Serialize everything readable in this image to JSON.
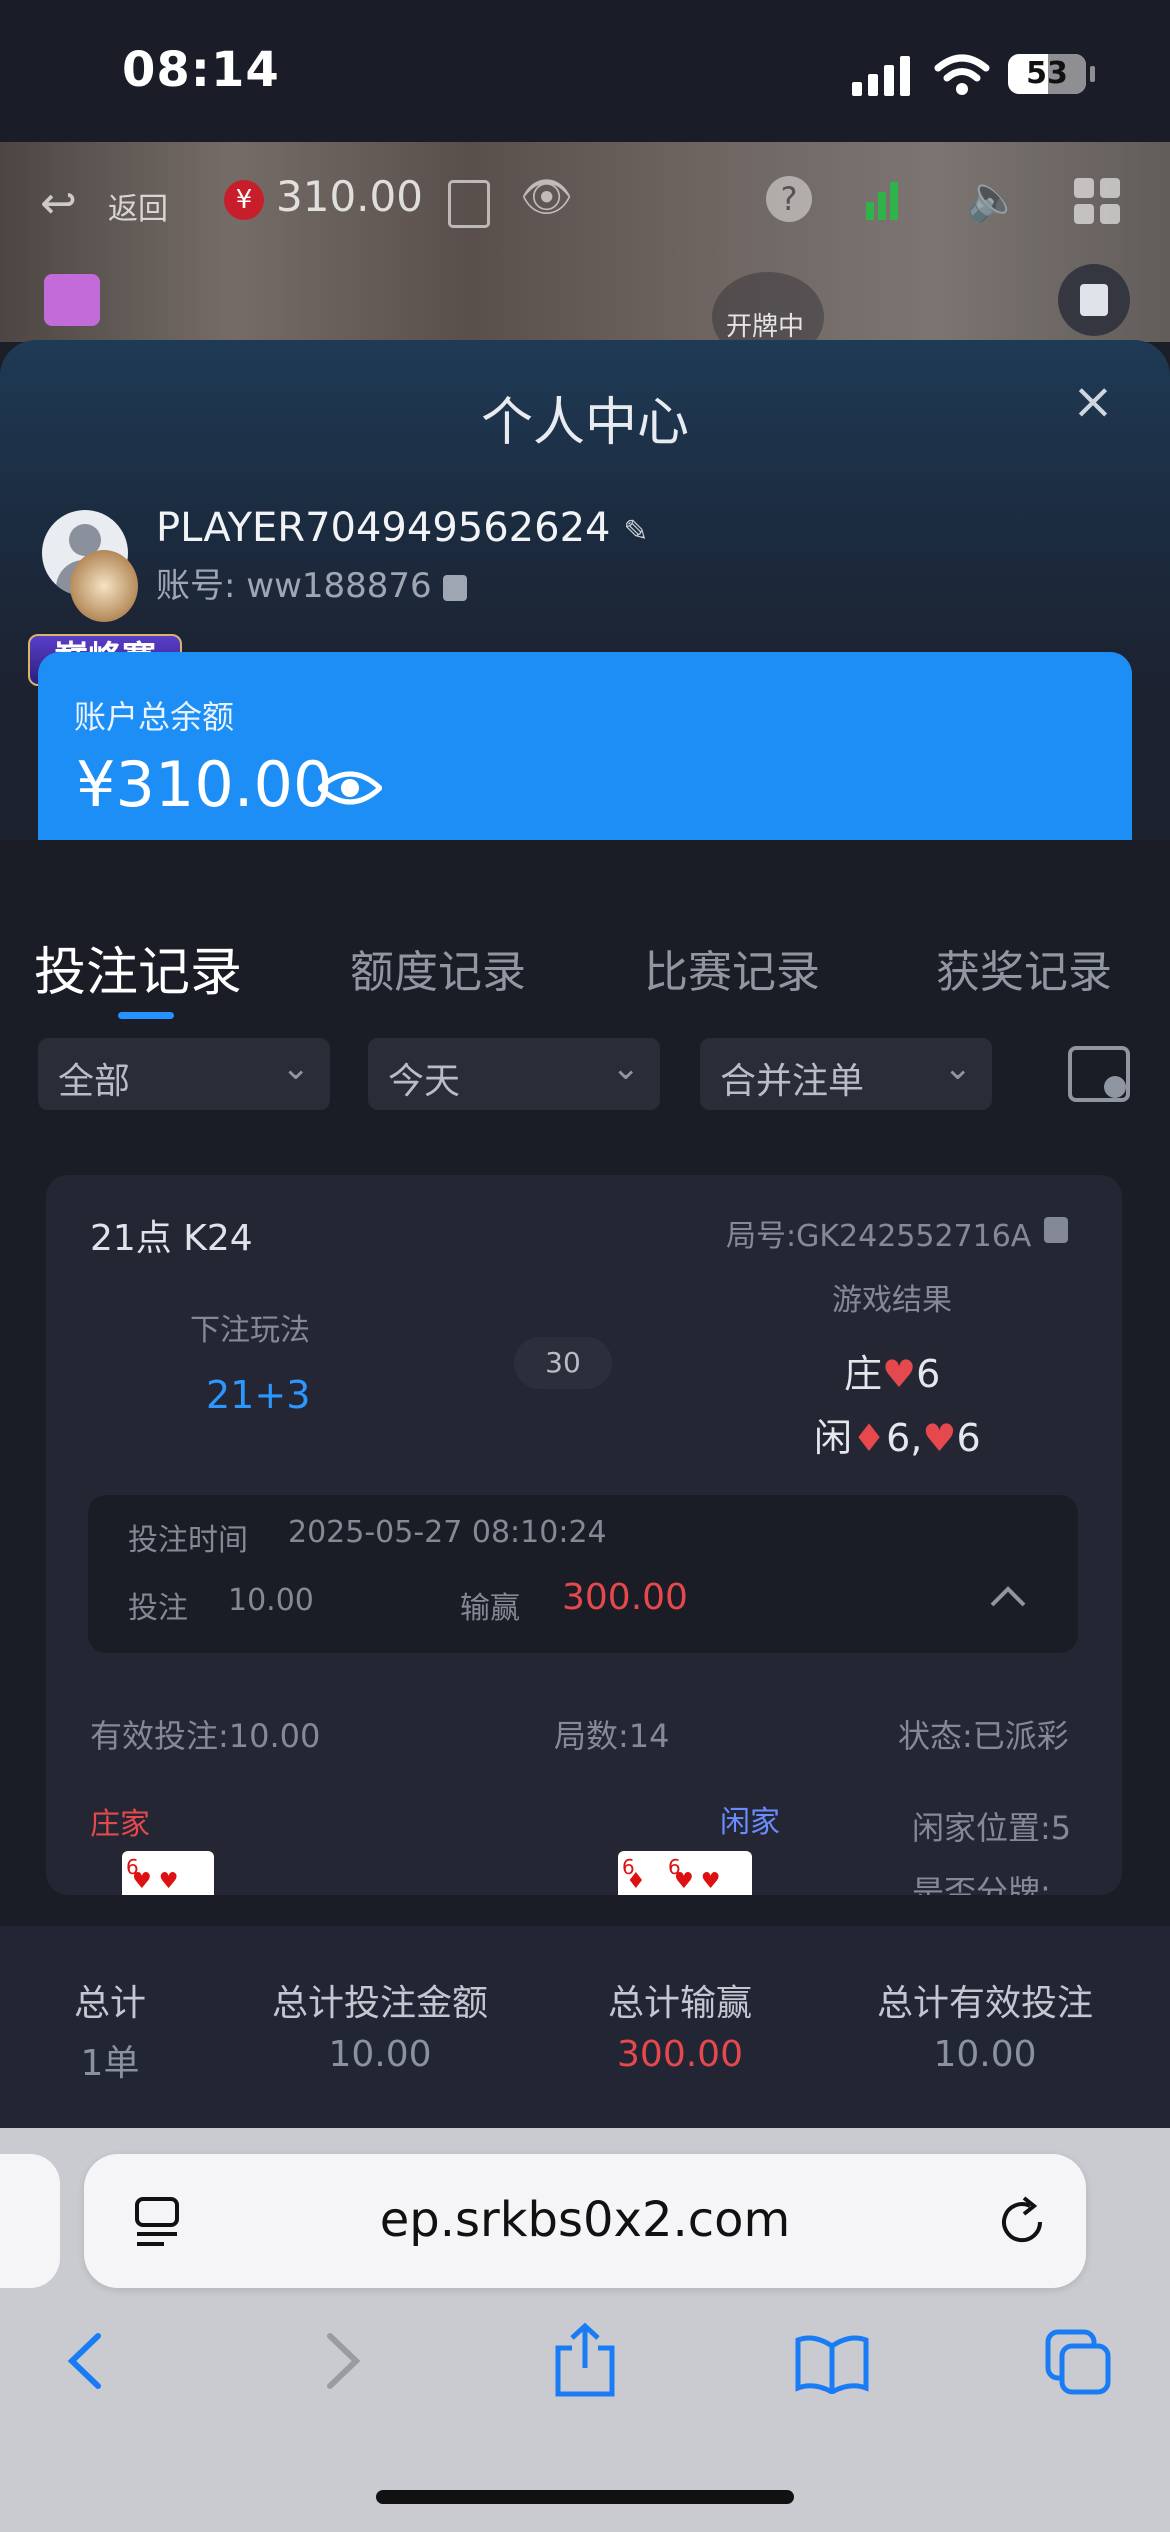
{
  "status_bar": {
    "time": "08:14",
    "battery": "53"
  },
  "video_bar": {
    "back_label": "返回",
    "balance": "310.00",
    "status_text": "开牌中"
  },
  "panel": {
    "title": "个人中心",
    "close_symbol": "×",
    "player_name": "PLAYER704949562624",
    "account_label": "账号:",
    "account_id": "ww188876",
    "badge_text": "巅峰赛",
    "balance_label": "账户总余额",
    "balance_amount": "¥310.00"
  },
  "tabs": [
    {
      "label": "投注记录",
      "active": true
    },
    {
      "label": "额度记录",
      "active": false
    },
    {
      "label": "比赛记录",
      "active": false
    },
    {
      "label": "获奖记录",
      "active": false
    }
  ],
  "filters": [
    {
      "value": "全部"
    },
    {
      "value": "今天"
    },
    {
      "value": "合并注单"
    }
  ],
  "record": {
    "game": "21点 K24",
    "round_no": "局号:GK242552716A",
    "bet_type_label": "下注玩法",
    "bet_type_value": "21+3",
    "odds": "30",
    "result_label": "游戏结果",
    "banker_result_prefix": "庄",
    "banker_result": "6",
    "player_result_prefix": "闲",
    "player_result_a": "6,",
    "player_result_b": "6",
    "bet_time_label": "投注时间",
    "bet_time": "2025-05-27 08:10:24",
    "bet_label": "投注",
    "bet_amount": "10.00",
    "win_label": "输赢",
    "win_amount": "300.00",
    "valid_bet": "有效投注:10.00",
    "rounds": "局数:14",
    "status": "状态:已派彩",
    "banker_label": "庄家",
    "player_label": "闲家",
    "player_position": "闲家位置:5",
    "split_label": "是否分牌:",
    "card_6": "6"
  },
  "summary": {
    "headers": [
      "总计",
      "总计投注金额",
      "总计输赢",
      "总计有效投注"
    ],
    "values": [
      "1单",
      "10.00",
      "300.00",
      "10.00"
    ]
  },
  "browser": {
    "url": "ep.srkbs0x2.com"
  },
  "colors": {
    "accent": "#1d8ef5",
    "loss_win_red": "#e5484d",
    "link_blue": "#2b97ff"
  }
}
